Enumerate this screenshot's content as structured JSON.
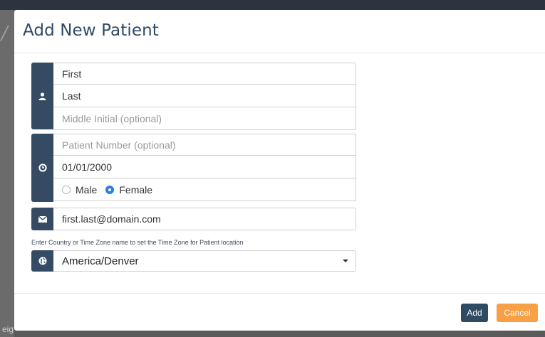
{
  "modal": {
    "title": "Add New Patient",
    "name_group": {
      "icon": "user-icon",
      "first_value": "First",
      "last_value": "Last",
      "middle_placeholder": "Middle Initial  (optional)"
    },
    "details_group": {
      "icon": "clock-icon",
      "patient_number_placeholder": "Patient Number (optional)",
      "dob_value": "01/01/2000",
      "gender_options": [
        "Male",
        "Female"
      ],
      "gender_selected": "Female"
    },
    "email_group": {
      "icon": "envelope-icon",
      "email_value": "first.last@domain.com"
    },
    "timezone_hint": "Enter Country or Time Zone name to set the Time Zone for Patient location",
    "timezone_group": {
      "icon": "globe-icon",
      "selected": "America/Denver"
    },
    "footer": {
      "add_label": "Add",
      "cancel_label": "Cancel"
    }
  },
  "backdrop": {
    "partial_text": "eig"
  },
  "colors": {
    "primary": "#354b63",
    "accent_orange": "#f7a046",
    "radio_selected": "#2b7de9"
  }
}
